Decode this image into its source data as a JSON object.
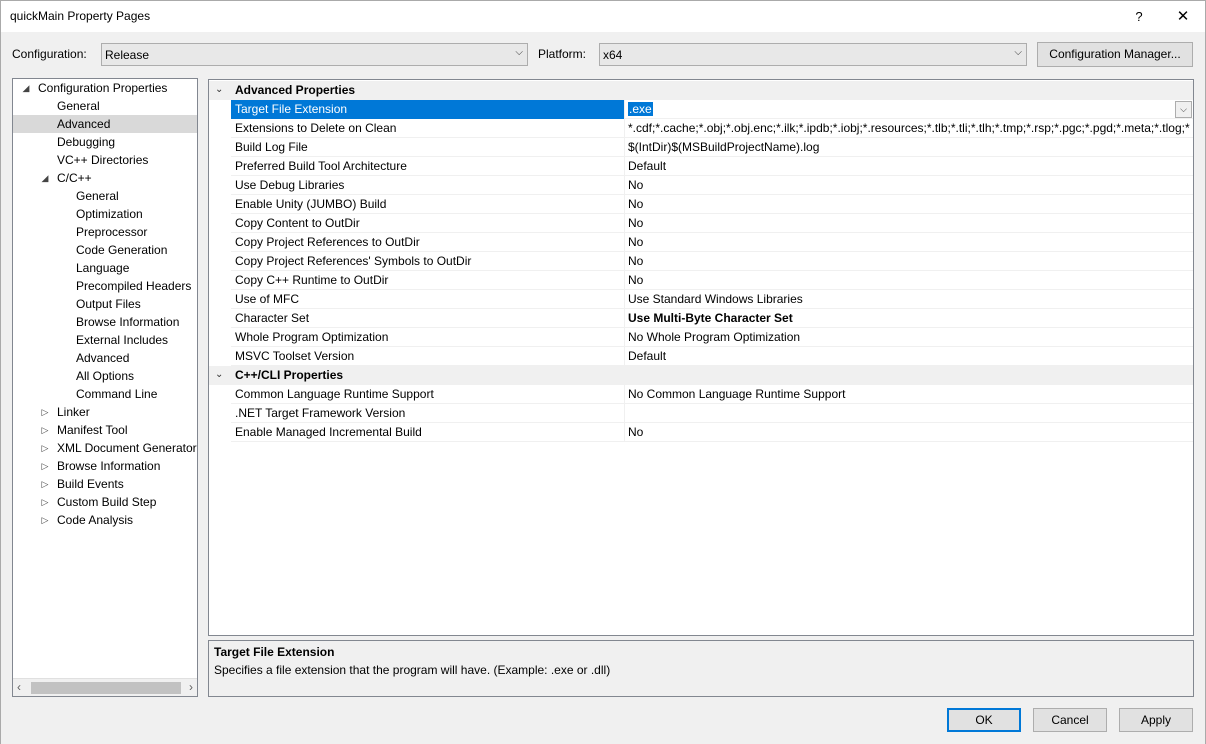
{
  "window": {
    "title": "quickMain Property Pages",
    "help": "?",
    "close": "✕"
  },
  "config": {
    "label": "Configuration:",
    "value": "Release",
    "platform_label": "Platform:",
    "platform_value": "x64",
    "manager_button": "Configuration Manager..."
  },
  "tree": [
    {
      "label": "Configuration Properties",
      "level": 0,
      "expander": "◢"
    },
    {
      "label": "General",
      "level": 1
    },
    {
      "label": "Advanced",
      "level": 1,
      "selected": true
    },
    {
      "label": "Debugging",
      "level": 1
    },
    {
      "label": "VC++ Directories",
      "level": 1
    },
    {
      "label": "C/C++",
      "level": 1,
      "expander": "◢"
    },
    {
      "label": "General",
      "level": 2
    },
    {
      "label": "Optimization",
      "level": 2
    },
    {
      "label": "Preprocessor",
      "level": 2
    },
    {
      "label": "Code Generation",
      "level": 2
    },
    {
      "label": "Language",
      "level": 2
    },
    {
      "label": "Precompiled Headers",
      "level": 2
    },
    {
      "label": "Output Files",
      "level": 2
    },
    {
      "label": "Browse Information",
      "level": 2
    },
    {
      "label": "External Includes",
      "level": 2
    },
    {
      "label": "Advanced",
      "level": 2
    },
    {
      "label": "All Options",
      "level": 2
    },
    {
      "label": "Command Line",
      "level": 2
    },
    {
      "label": "Linker",
      "level": 1,
      "expander": "▷"
    },
    {
      "label": "Manifest Tool",
      "level": 1,
      "expander": "▷"
    },
    {
      "label": "XML Document Generator",
      "level": 1,
      "expander": "▷"
    },
    {
      "label": "Browse Information",
      "level": 1,
      "expander": "▷"
    },
    {
      "label": "Build Events",
      "level": 1,
      "expander": "▷"
    },
    {
      "label": "Custom Build Step",
      "level": 1,
      "expander": "▷"
    },
    {
      "label": "Code Analysis",
      "level": 1,
      "expander": "▷"
    }
  ],
  "grid": [
    {
      "type": "category",
      "name": "Advanced Properties",
      "expander": "⌄"
    },
    {
      "name": "Target File Extension",
      "value": ".exe",
      "selected": true
    },
    {
      "name": "Extensions to Delete on Clean",
      "value": "*.cdf;*.cache;*.obj;*.obj.enc;*.ilk;*.ipdb;*.iobj;*.resources;*.tlb;*.tli;*.tlh;*.tmp;*.rsp;*.pgc;*.pgd;*.meta;*.tlog;*"
    },
    {
      "name": "Build Log File",
      "value": "$(IntDir)$(MSBuildProjectName).log"
    },
    {
      "name": "Preferred Build Tool Architecture",
      "value": "Default"
    },
    {
      "name": "Use Debug Libraries",
      "value": "No"
    },
    {
      "name": "Enable Unity (JUMBO) Build",
      "value": "No"
    },
    {
      "name": "Copy Content to OutDir",
      "value": "No"
    },
    {
      "name": "Copy Project References to OutDir",
      "value": "No"
    },
    {
      "name": "Copy Project References' Symbols to OutDir",
      "value": "No"
    },
    {
      "name": "Copy C++ Runtime to OutDir",
      "value": "No"
    },
    {
      "name": "Use of MFC",
      "value": "Use Standard Windows Libraries"
    },
    {
      "name": "Character Set",
      "value": "Use Multi-Byte Character Set",
      "bold": true
    },
    {
      "name": "Whole Program Optimization",
      "value": "No Whole Program Optimization"
    },
    {
      "name": "MSVC Toolset Version",
      "value": "Default"
    },
    {
      "type": "category",
      "name": "C++/CLI Properties",
      "expander": "⌄"
    },
    {
      "name": "Common Language Runtime Support",
      "value": "No Common Language Runtime Support"
    },
    {
      "name": ".NET Target Framework Version",
      "value": ""
    },
    {
      "name": "Enable Managed Incremental Build",
      "value": "No"
    }
  ],
  "description": {
    "title": "Target File Extension",
    "text": "Specifies a file extension that the program will have. (Example: .exe or .dll)"
  },
  "buttons": {
    "ok": "OK",
    "cancel": "Cancel",
    "apply": "Apply"
  },
  "icons": {
    "dropdown": "chevron-down-icon",
    "scroll_left": "‹",
    "scroll_right": "›"
  }
}
